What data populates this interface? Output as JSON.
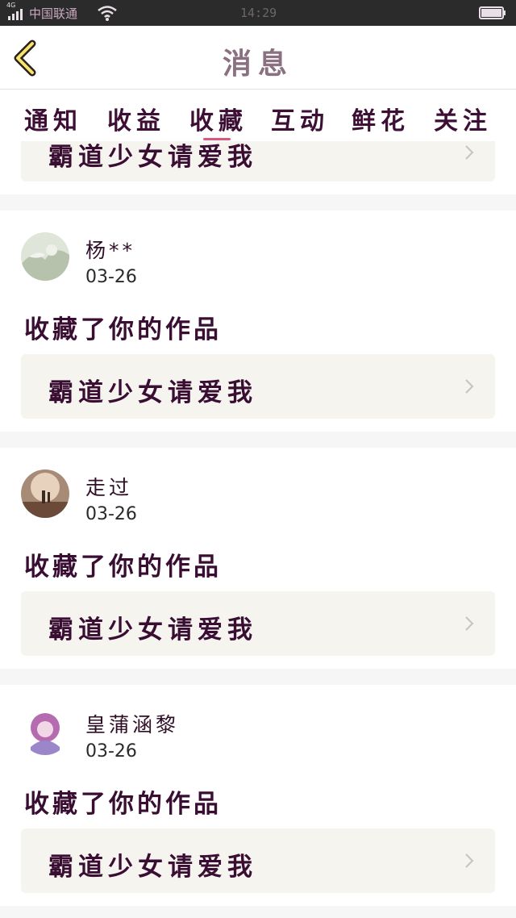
{
  "status_bar": {
    "network": "4G",
    "carrier": "中国联通",
    "time": "14:29"
  },
  "header": {
    "back_icon": "chevron-left-icon",
    "title": "消息"
  },
  "tabs": [
    {
      "label": "通知"
    },
    {
      "label": "收益"
    },
    {
      "label": "收藏"
    },
    {
      "label": "互动"
    },
    {
      "label": "鲜花"
    },
    {
      "label": "关注"
    }
  ],
  "active_tab": "收藏",
  "partial_item": {
    "work_title": "霸道少女请爱我"
  },
  "items": [
    {
      "username": "杨**",
      "date": "03-26",
      "action": "收藏了你的作品",
      "work_title": "霸道少女请爱我"
    },
    {
      "username": "走过",
      "date": "03-26",
      "action": "收藏了你的作品",
      "work_title": "霸道少女请爱我"
    },
    {
      "username": "皇蒲涵黎",
      "date": "03-26",
      "action": "收藏了你的作品",
      "work_title": "霸道少女请爱我"
    }
  ],
  "colors": {
    "accent": "#d9577f",
    "text_dark": "#3a0e33",
    "card_bg": "#f5f4ef"
  }
}
